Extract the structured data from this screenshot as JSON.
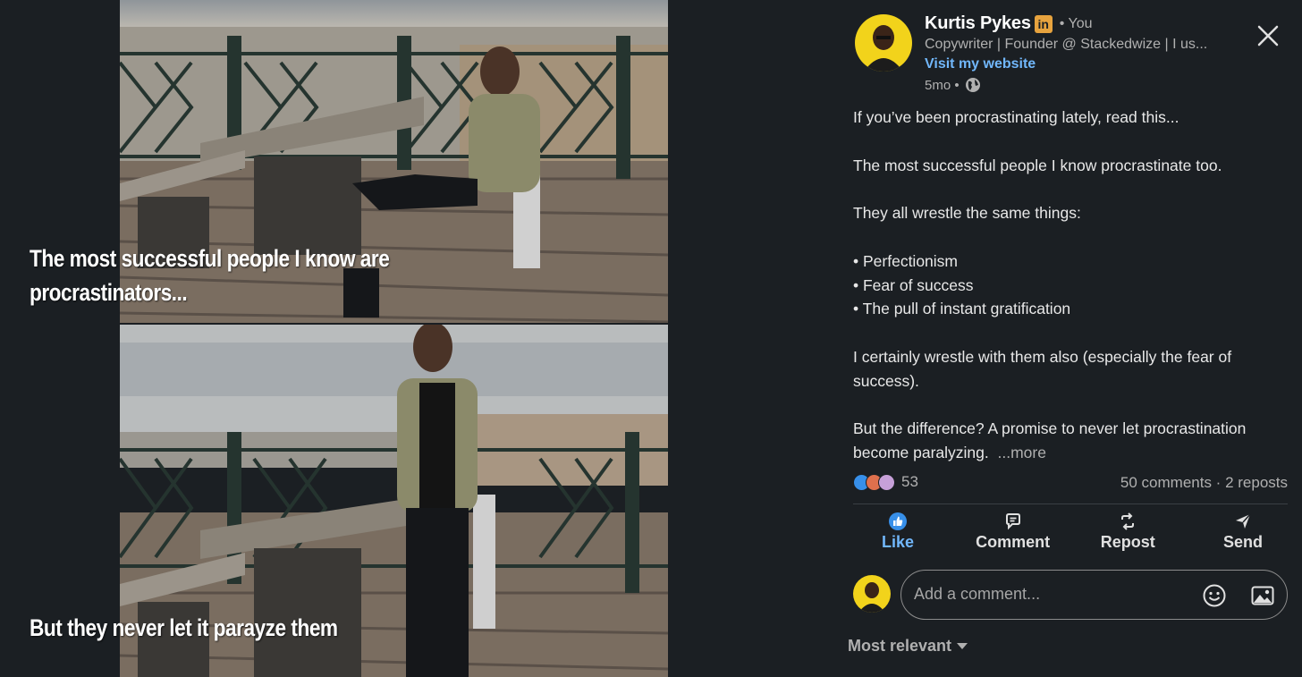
{
  "image": {
    "caption_top": "The most successful people I know are procrastinators...",
    "caption_bottom": "But they never let it parayze them"
  },
  "post": {
    "author_name": "Kurtis Pykes",
    "badge": "in",
    "you_label": "• You",
    "headline": "Copywriter | Founder @ Stackedwize | I us...",
    "website_link": "Visit my website",
    "time": "5mo •",
    "paragraphs": [
      "If you’ve been procrastinating lately, read this...",
      "",
      "The most successful people I know procrastinate too.",
      "",
      "They all wrestle the same things:",
      "",
      "• Perfectionism",
      "• Fear of success",
      "• The pull of instant gratification",
      "",
      "I certainly wrestle with them also (especially the fear of success).",
      "",
      "But the difference? A promise to never let procrastination become paralyzing."
    ],
    "more_label": "...more",
    "reaction_count": "53",
    "stats": "50 comments · 2 reposts"
  },
  "actions": {
    "like": "Like",
    "comment": "Comment",
    "repost": "Repost",
    "send": "Send"
  },
  "comment": {
    "placeholder": "Add a comment..."
  },
  "sort": {
    "label": "Most relevant"
  },
  "icons": {
    "close": "close-icon",
    "globe": "globe-icon",
    "like": "thumbs-up-icon",
    "comment": "speech-bubble-icon",
    "repost": "repost-arrows-icon",
    "send": "paper-plane-icon",
    "emoji": "smiley-icon",
    "image": "image-icon",
    "chevron": "chevron-down-icon"
  },
  "colors": {
    "background": "#1b1f23",
    "link": "#71b7fb",
    "badge": "#e7a33e",
    "avatar_bg": "#f2d31b"
  }
}
